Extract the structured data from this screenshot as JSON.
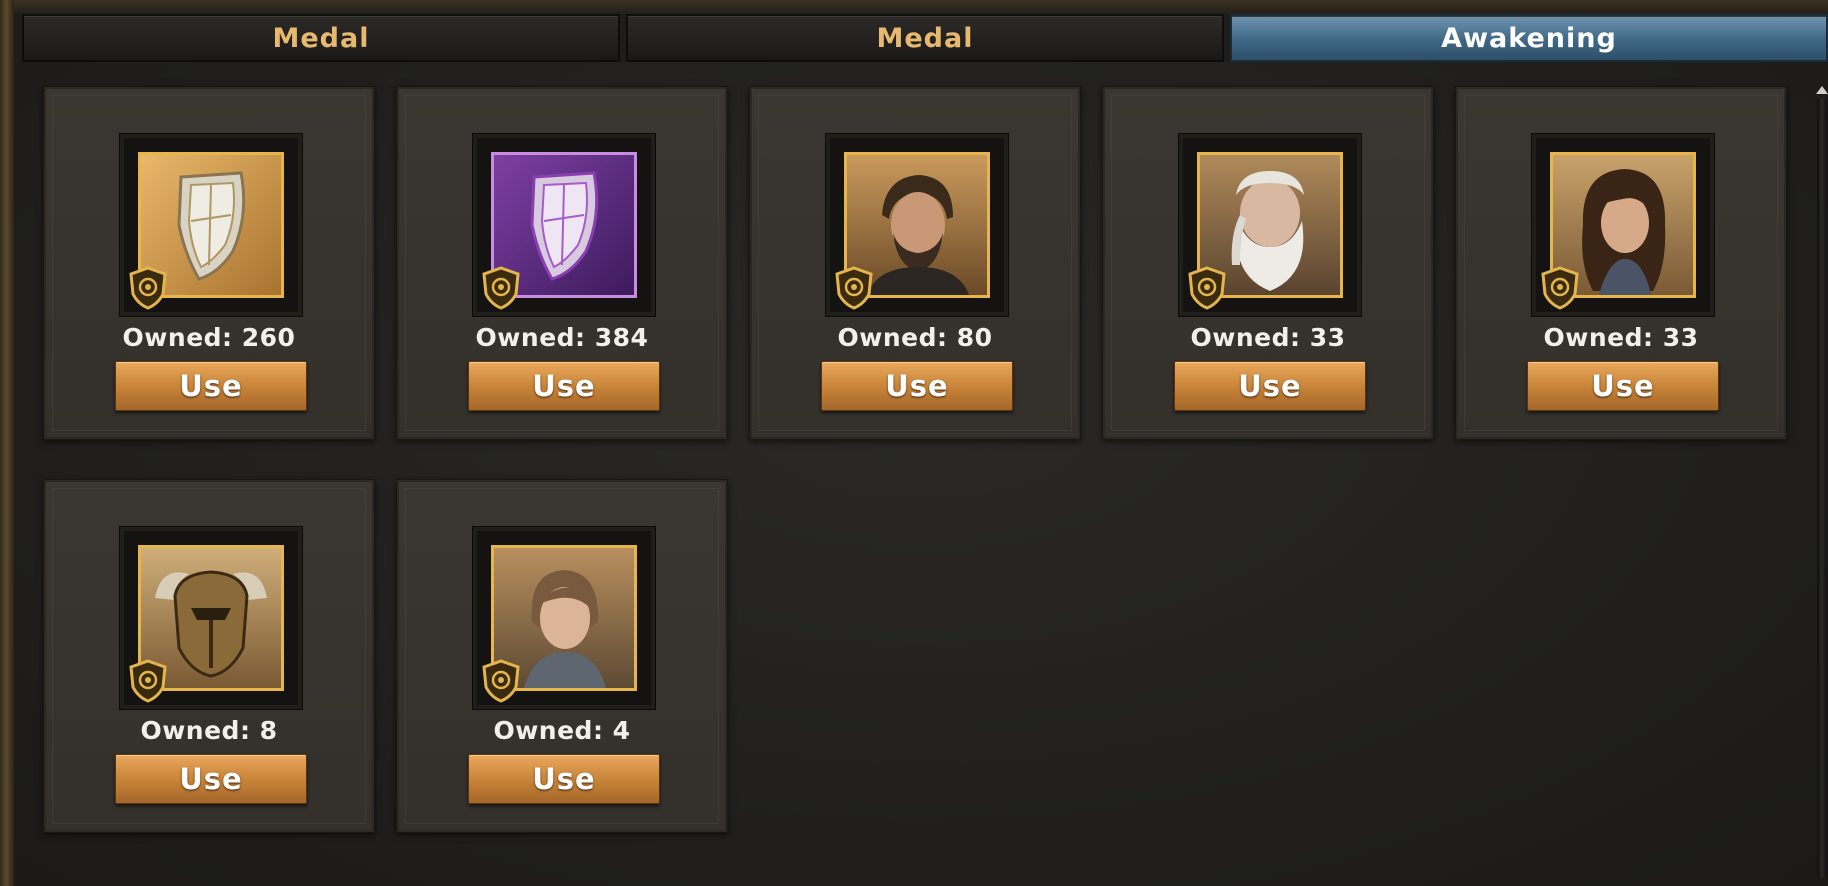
{
  "tabs": [
    {
      "label": "Medal",
      "active": false
    },
    {
      "label": "Medal",
      "active": false
    },
    {
      "label": "Awakening",
      "active": true
    }
  ],
  "colors": {
    "tab_text": "#e7b96e",
    "active_tab": "#3f6885",
    "button": "#c98539",
    "frame_gold": "#e6b64a"
  },
  "items": [
    {
      "icon": "silver-shield-medal-icon",
      "owned_label": "Owned: 260",
      "button_label": "Use"
    },
    {
      "icon": "purple-shield-medal-icon",
      "owned_label": "Owned: 384",
      "button_label": "Use"
    },
    {
      "icon": "bearded-man-portrait-icon",
      "owned_label": "Owned: 80",
      "button_label": "Use"
    },
    {
      "icon": "white-beard-elder-portrait-icon",
      "owned_label": "Owned: 33",
      "button_label": "Use"
    },
    {
      "icon": "dark-haired-woman-portrait-icon",
      "owned_label": "Owned: 33",
      "button_label": "Use"
    },
    {
      "icon": "horned-bull-helmet-icon",
      "owned_label": "Owned: 8",
      "button_label": "Use"
    },
    {
      "icon": "short-haired-woman-portrait-icon",
      "owned_label": "Owned: 4",
      "button_label": "Use"
    }
  ]
}
